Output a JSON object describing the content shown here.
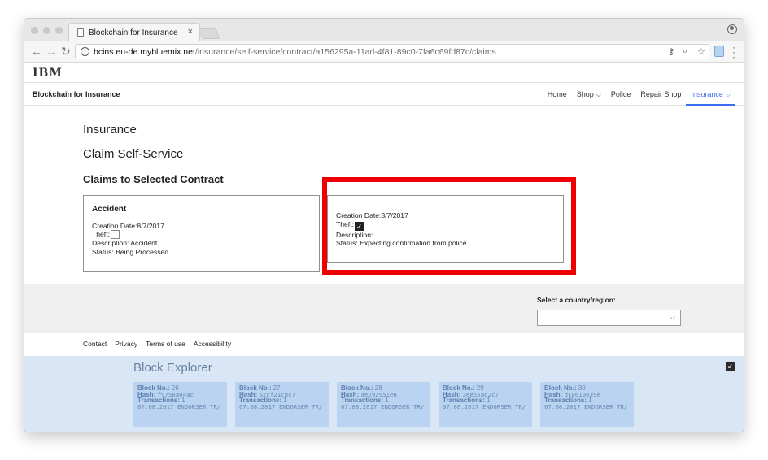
{
  "browser": {
    "tab_title": "Blockchain for Insurance",
    "tab_close": "×",
    "url_host": "bcins.eu-de.mybluemix.net",
    "url_path": "/insurance/self-service/contract/a156295a-11ad-4f81-89c0-7fa6c69fd87c/claims",
    "icons": {
      "back": "back-arrow-icon",
      "forward": "forward-arrow-icon",
      "reload": "reload-icon",
      "info": "info-icon",
      "key": "key-icon",
      "zoom": "zoom-icon",
      "star": "bookmark-star-icon",
      "menu": "menu-dots-icon"
    }
  },
  "site": {
    "logo": "IBM",
    "brand": "Blockchain for Insurance",
    "nav": [
      {
        "label": "Home"
      },
      {
        "label": "Shop",
        "has_dropdown": true
      },
      {
        "label": "Police"
      },
      {
        "label": "Repair Shop"
      },
      {
        "label": "Insurance",
        "has_dropdown": true,
        "active": true
      }
    ],
    "accent_color": "#3c6df0"
  },
  "main": {
    "title": "Insurance",
    "subtitle": "Claim Self-Service",
    "section_title": "Claims to Selected Contract",
    "claims": [
      {
        "title": "Accident",
        "creation_date": "Creation Date:8/7/2017",
        "theft_label": "Theft:",
        "theft_checked": false,
        "description": "Description: Accident",
        "status": "Status: Being Processed"
      },
      {
        "title": "",
        "creation_date": "Creation Date:8/7/2017",
        "theft_label": "Theft:",
        "theft_checked": true,
        "description": "Description:",
        "status": "Status: Expecting confirmation from police"
      }
    ],
    "highlight_color": "#ee0000"
  },
  "footer": {
    "country_label": "Select a country/region:",
    "country_value": "",
    "links": [
      "Contact",
      "Privacy",
      "Terms of use",
      "Accessibility"
    ]
  },
  "block_explorer": {
    "title": "Block Explorer",
    "labels": {
      "block": "Block No.:",
      "hash": "Hash:",
      "transactions": "Transactions:"
    },
    "blocks": [
      {
        "no": "26",
        "hash": "f9758a04ac",
        "transactions": "1",
        "entry": "07.08.2017 ENDORSER TR/"
      },
      {
        "no": "27",
        "hash": "52cf21c8c7",
        "transactions": "1",
        "entry": "07.08.2017 ENDORSER TR/"
      },
      {
        "no": "28",
        "hash": "ae292951e6",
        "transactions": "1",
        "entry": "07.08.2017 ENDORSER TR/"
      },
      {
        "no": "29",
        "hash": "3ee55ad2c7",
        "transactions": "1",
        "entry": "07.08.2017 ENDORSER TR/"
      },
      {
        "no": "30",
        "hash": "d18619639e",
        "transactions": "1",
        "entry": "07.08.2017 ENDORSER TR/"
      }
    ]
  }
}
